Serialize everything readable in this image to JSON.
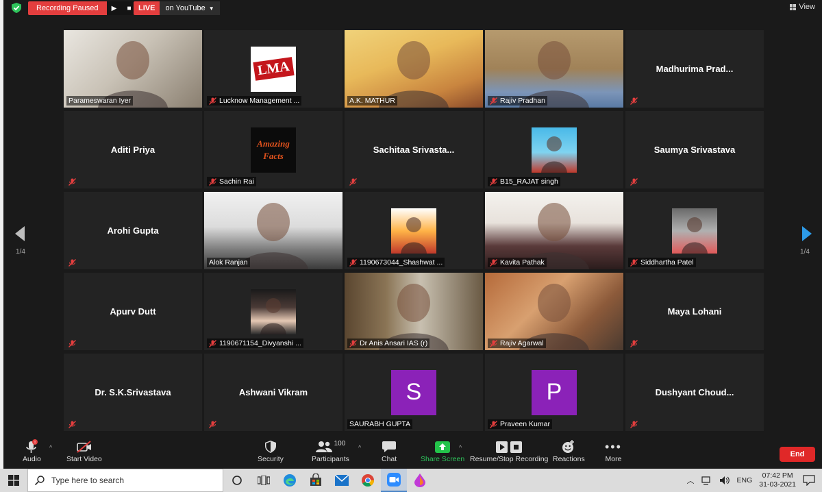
{
  "topbar": {
    "recording_label": "Recording Paused",
    "live_label": "LIVE",
    "live_destination": "on YouTube",
    "view_label": "View"
  },
  "navigation": {
    "page_left": "1/4",
    "page_right": "1/4"
  },
  "participants": [
    {
      "name": "Parameswaran Iyer",
      "type": "video",
      "muted": false,
      "active": true
    },
    {
      "name": "Lucknow Management ...",
      "type": "logo",
      "logo_text": "LMA",
      "muted": true
    },
    {
      "name": "A.K. MATHUR",
      "type": "video",
      "muted": false
    },
    {
      "name": "Rajiv Pradhan",
      "type": "video",
      "muted": true
    },
    {
      "name": "Madhurima  Prad...",
      "type": "name",
      "muted": true
    },
    {
      "name": "Aditi Priya",
      "type": "name",
      "muted": true
    },
    {
      "name": "Sachin Rai",
      "type": "logo",
      "logo_text": "Amazing Facts",
      "muted": true
    },
    {
      "name": "Sachitaa  Srivasta...",
      "type": "name",
      "muted": true
    },
    {
      "name": "B15_RAJAT singh",
      "type": "photo",
      "muted": true
    },
    {
      "name": "Saumya Srivastava",
      "type": "name",
      "muted": true
    },
    {
      "name": "Arohi Gupta",
      "type": "name",
      "muted": true
    },
    {
      "name": "Alok Ranjan",
      "type": "video",
      "muted": false
    },
    {
      "name": "1190673044_Shashwat ...",
      "type": "photo",
      "muted": true
    },
    {
      "name": "Kavita Pathak",
      "type": "video",
      "muted": true
    },
    {
      "name": "Siddhartha Patel",
      "type": "photo",
      "muted": true
    },
    {
      "name": "Apurv Dutt",
      "type": "name",
      "muted": true
    },
    {
      "name": "1190671154_Divyanshi ...",
      "type": "photo",
      "muted": true
    },
    {
      "name": "Dr Anis Ansari IAS (r)",
      "type": "video",
      "muted": true
    },
    {
      "name": "Rajiv Agarwal",
      "type": "video",
      "muted": true
    },
    {
      "name": "Maya Lohani",
      "type": "name",
      "muted": true
    },
    {
      "name": "Dr. S.K.Srivastava",
      "type": "name",
      "muted": true
    },
    {
      "name": "Ashwani Vikram",
      "type": "name",
      "muted": true
    },
    {
      "name": "SAURABH GUPTA",
      "type": "letter",
      "letter": "S",
      "muted": false
    },
    {
      "name": "Praveen Kumar",
      "type": "letter",
      "letter": "P",
      "muted": true
    },
    {
      "name": "Dushyant  Choud...",
      "type": "name",
      "muted": true
    }
  ],
  "toolbar": {
    "audio_label": "Audio",
    "video_label": "Start Video",
    "security_label": "Security",
    "participants_label": "Participants",
    "participants_count": "100",
    "chat_label": "Chat",
    "share_label": "Share Screen",
    "recording_label": "Resume/Stop Recording",
    "reactions_label": "Reactions",
    "more_label": "More",
    "end_label": "End"
  },
  "taskbar": {
    "search_placeholder": "Type here to search",
    "language": "ENG",
    "time": "07:42 PM",
    "date": "31-03-2021"
  },
  "colors": {
    "accent_red": "#e33e3e",
    "active_speaker": "#c7e36b",
    "share_green": "#23c34a",
    "nav_blue": "#2d9be8",
    "avatar_purple": "#8b22b8"
  }
}
